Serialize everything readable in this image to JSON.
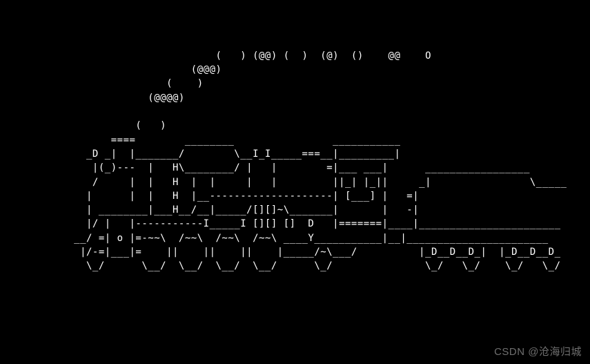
{
  "terminal": {
    "ascii_art": "\n\n\n                                   (   ) (@@) (  )  (@)  ()    @@    O\n                               (@@@)\n                           (    )\n                        (@@@@)\n\n                      (   )\n                  ====        ________                ___________\n              _D _|  |_______/        \\__I_I_____===__|_________|\n               |(_)---  |   H\\________/ |   |        =|___ ___|      _________________\n               /     |  |   H  |  |     |   |         ||_| |_||     _|                \\_____\n              |      |  |   H  |__--------------------| [___] |   =|\n              | ________|___H__/__|_____/[][]~\\_______|       |   -|\n              |/ |   |-----------I_____I [][] []  D   |=======|____|_______________________\n            __/ =| o |=-~~\\  /~~\\  /~~\\  /~~\\ ____Y___________|__|_______________________\n             |/-=|___|=    ||    ||    ||    |_____/~\\___/          |_D__D__D_|  |_D__D__D_\n              \\_/      \\__/  \\__/  \\__/  \\__/      \\_/               \\_/   \\_/    \\_/   \\_/"
  },
  "watermark": {
    "text": "CSDN @沧海归城"
  }
}
